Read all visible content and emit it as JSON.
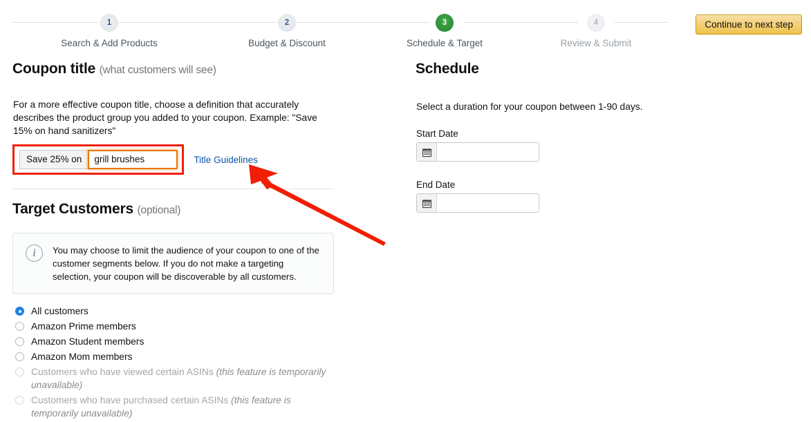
{
  "stepper": {
    "steps": [
      {
        "number": "1",
        "label": "Search & Add Products",
        "state": "done"
      },
      {
        "number": "2",
        "label": "Budget & Discount",
        "state": "done"
      },
      {
        "number": "3",
        "label": "Schedule & Target",
        "state": "active"
      },
      {
        "number": "4",
        "label": "Review & Submit",
        "state": "todo"
      }
    ],
    "continue_label": "Continue to next step",
    "active_color": "#2f8f3a",
    "done_number_color": "#2b5797",
    "button_color": "#f0c14b"
  },
  "coupon_title": {
    "heading": "Coupon title",
    "heading_sub": "(what customers will see)",
    "description": "For a more effective coupon title, choose a definition that accurately describes the product group you added to your coupon.  Example: \"Save 15% on hand sanitizers\"",
    "prefix": "Save 25% on",
    "input_value": "grill brushes",
    "input_placeholder": "",
    "guidelines_link": "Title Guidelines",
    "link_color": "#0c56a8",
    "highlight_color": "#f01f06"
  },
  "target_customers": {
    "heading": "Target Customers",
    "heading_sub": "(optional)",
    "info_icon": "info-icon",
    "info_text": "You may choose to limit the audience of your coupon to one of the customer segments below. If you do not make a targeting selection, your coupon will be discoverable by all customers.",
    "options": [
      {
        "label": "All customers",
        "note": "",
        "selected": true,
        "disabled": false
      },
      {
        "label": "Amazon Prime members",
        "note": "",
        "selected": false,
        "disabled": false
      },
      {
        "label": "Amazon Student members",
        "note": "",
        "selected": false,
        "disabled": false
      },
      {
        "label": "Amazon Mom members",
        "note": "",
        "selected": false,
        "disabled": false
      },
      {
        "label": "Customers who have viewed certain ASINs",
        "note": "(this feature is temporarily unavailable)",
        "selected": false,
        "disabled": true
      },
      {
        "label": "Customers who have purchased certain ASINs",
        "note": "(this feature is temporarily unavailable)",
        "selected": false,
        "disabled": true
      }
    ]
  },
  "schedule": {
    "heading": "Schedule",
    "description": "Select a duration for your coupon between 1-90 days.",
    "start_label": "Start Date",
    "start_value": "",
    "start_placeholder": "",
    "end_label": "End Date",
    "end_value": "",
    "end_placeholder": "",
    "calendar_icon": "calendar-icon"
  },
  "annotation": {
    "arrow_color": "#f01f06",
    "arrow_target": "Title Guidelines"
  }
}
